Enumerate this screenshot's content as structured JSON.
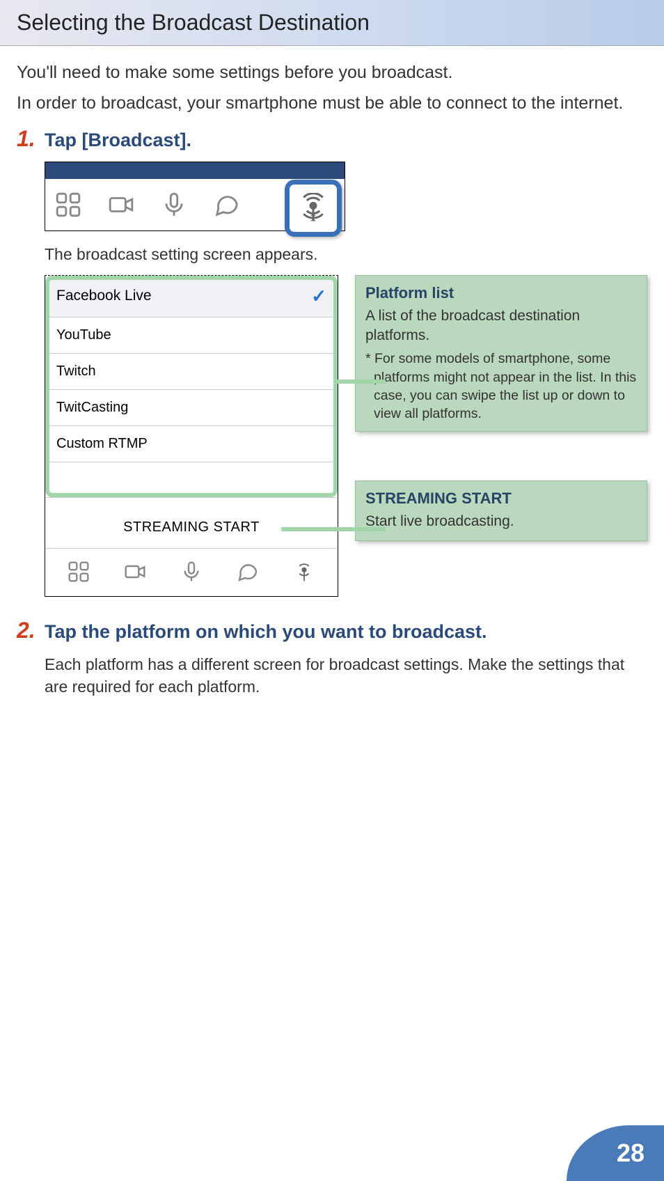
{
  "header": {
    "title": "Selecting the Broadcast Destination"
  },
  "intro": {
    "line1": "You'll need to make some settings before you broadcast.",
    "line2": "In order to broadcast, your smartphone must be able to connect to the internet."
  },
  "step1": {
    "num": "1.",
    "title": "Tap [Broadcast].",
    "caption": "The broadcast setting screen appears."
  },
  "platforms": {
    "items": [
      {
        "label": "Facebook Live",
        "selected": true
      },
      {
        "label": "YouTube",
        "selected": false
      },
      {
        "label": "Twitch",
        "selected": false
      },
      {
        "label": "TwitCasting",
        "selected": false
      },
      {
        "label": "Custom RTMP",
        "selected": false
      }
    ]
  },
  "streaming_start": "STREAMING START",
  "callout1": {
    "title": "Platform list",
    "text": "A list of the broadcast destination platforms.",
    "note": "* For some models of smartphone, some platforms might not appear in the list. In this case, you can swipe the list up or down to view all platforms."
  },
  "callout2": {
    "title": "STREAMING START",
    "text": "Start live broadcasting."
  },
  "step2": {
    "num": "2.",
    "title": "Tap the platform on which you want to broadcast.",
    "desc": "Each platform has a different screen for broadcast settings. Make the settings that are required for each platform."
  },
  "page_number": "28"
}
